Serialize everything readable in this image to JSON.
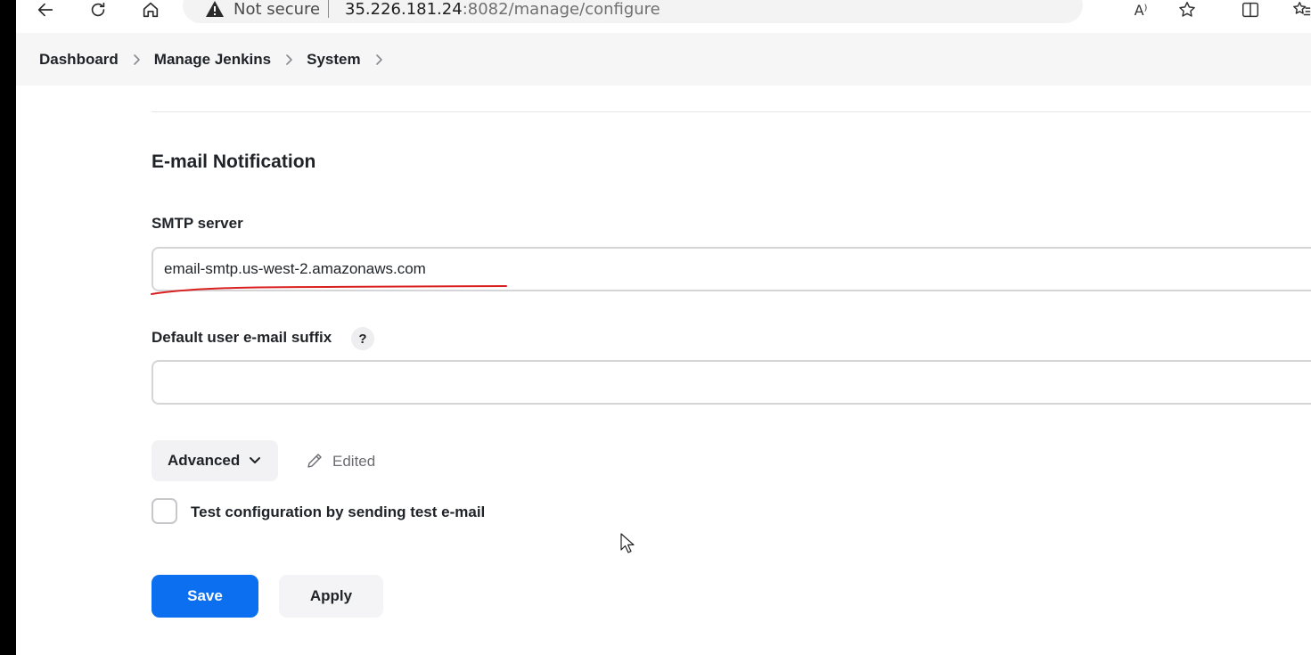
{
  "browser": {
    "security_label": "Not secure",
    "url_host": "35.226.181.24",
    "url_rest": ":8082/manage/configure",
    "read_aloud_glyph": "A⁾"
  },
  "breadcrumb": {
    "items": [
      "Dashboard",
      "Manage Jenkins",
      "System"
    ]
  },
  "section": {
    "title": "E-mail Notification"
  },
  "smtp": {
    "label": "SMTP server",
    "value": "email-smtp.us-west-2.amazonaws.com"
  },
  "suffix": {
    "label": "Default user e-mail suffix",
    "help": "?",
    "value": ""
  },
  "advanced": {
    "label": "Advanced",
    "status": "Edited"
  },
  "test_config": {
    "label": "Test configuration by sending test e-mail",
    "checked": false
  },
  "actions": {
    "save": "Save",
    "apply": "Apply"
  },
  "colors": {
    "primary": "#0b6ff0",
    "annotation": "#d9201f"
  }
}
